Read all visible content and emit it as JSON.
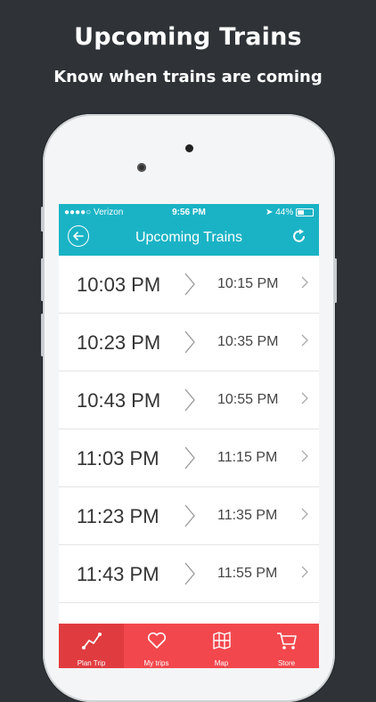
{
  "promo": {
    "title": "Upcoming Trains",
    "subtitle": "Know when trains are coming"
  },
  "status_bar": {
    "carrier": "●●●●○ Verizon",
    "time": "9:56 PM",
    "battery": "44%"
  },
  "nav": {
    "title": "Upcoming Trains"
  },
  "trains": [
    {
      "depart": "10:03 PM",
      "arrive": "10:15 PM"
    },
    {
      "depart": "10:23 PM",
      "arrive": "10:35 PM"
    },
    {
      "depart": "10:43 PM",
      "arrive": "10:55 PM"
    },
    {
      "depart": "11:03 PM",
      "arrive": "11:15 PM"
    },
    {
      "depart": "11:23 PM",
      "arrive": "11:35 PM"
    },
    {
      "depart": "11:43 PM",
      "arrive": "11:55 PM"
    }
  ],
  "tabs": [
    {
      "label": "Plan Trip",
      "icon": "plan-trip-icon",
      "active": true
    },
    {
      "label": "My trips",
      "icon": "heart-icon",
      "active": false
    },
    {
      "label": "Map",
      "icon": "map-icon",
      "active": false
    },
    {
      "label": "Store",
      "icon": "cart-icon",
      "active": false
    }
  ],
  "colors": {
    "background": "#2f3338",
    "nav": "#1ab3c5",
    "tabbar": "#f2484d"
  }
}
